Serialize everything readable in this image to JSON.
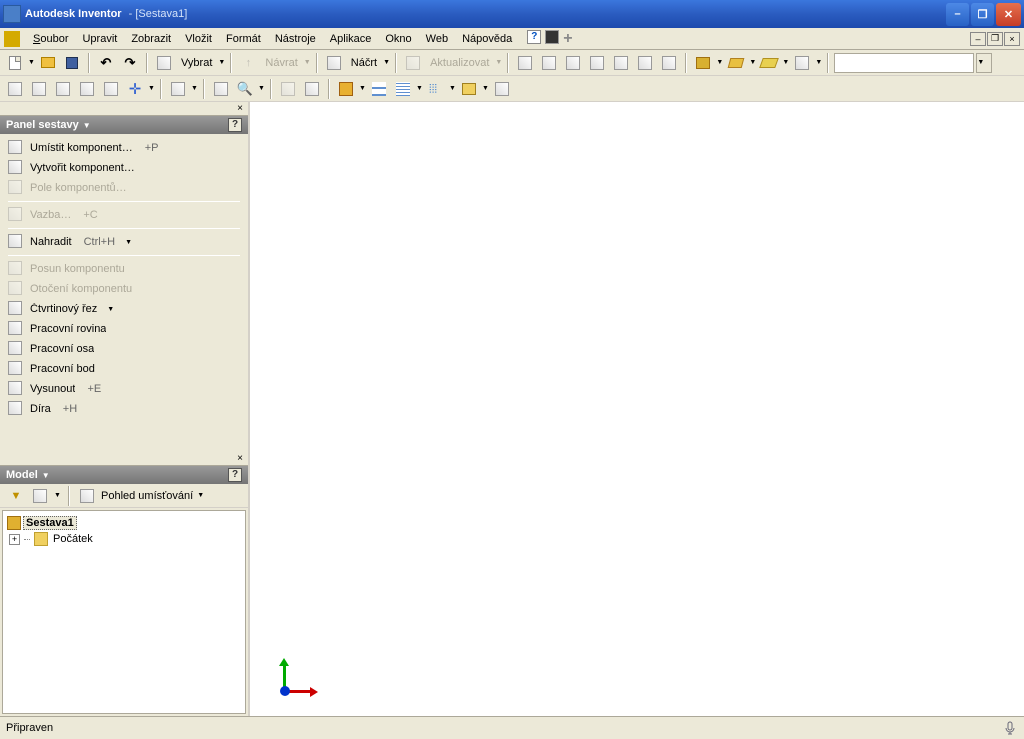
{
  "titlebar": {
    "app": "Autodesk Inventor",
    "doc": "[Sestava1]"
  },
  "menu": {
    "items": [
      "Soubor",
      "Upravit",
      "Zobrazit",
      "Vložit",
      "Formát",
      "Nástroje",
      "Aplikace",
      "Okno",
      "Web",
      "Nápověda"
    ]
  },
  "toolbar1": {
    "select_label": "Vybrat",
    "return_label": "Návrat",
    "sketch_label": "Náčrt",
    "update_label": "Aktualizovat"
  },
  "panel_assembly": {
    "title": "Panel sestavy",
    "items": [
      {
        "label": "Umístit komponent…",
        "shortcut": "+P",
        "disabled": false,
        "dropdown": false
      },
      {
        "label": "Vytvořit komponent…",
        "shortcut": "",
        "disabled": false,
        "dropdown": false
      },
      {
        "label": "Pole komponentů…",
        "shortcut": "",
        "disabled": true,
        "dropdown": false
      },
      {
        "sep": true
      },
      {
        "label": "Vazba…",
        "shortcut": "+C",
        "disabled": true,
        "dropdown": false
      },
      {
        "sep": true
      },
      {
        "label": "Nahradit",
        "shortcut": "Ctrl+H",
        "disabled": false,
        "dropdown": true
      },
      {
        "sep": true
      },
      {
        "label": "Posun komponentu",
        "shortcut": "",
        "disabled": true,
        "dropdown": false
      },
      {
        "label": "Otočení komponentu",
        "shortcut": "",
        "disabled": true,
        "dropdown": false
      },
      {
        "label": "Čtvrtinový řez",
        "shortcut": "",
        "disabled": false,
        "dropdown": true
      },
      {
        "label": "Pracovní rovina",
        "shortcut": "",
        "disabled": false,
        "dropdown": false
      },
      {
        "label": "Pracovní osa",
        "shortcut": "",
        "disabled": false,
        "dropdown": false
      },
      {
        "label": "Pracovní bod",
        "shortcut": "",
        "disabled": false,
        "dropdown": false
      },
      {
        "label": "Vysunout",
        "shortcut": "+E",
        "disabled": false,
        "dropdown": false
      },
      {
        "label": "Díra",
        "shortcut": "+H",
        "disabled": false,
        "dropdown": false
      }
    ]
  },
  "panel_model": {
    "title": "Model",
    "view_label": "Pohled umísťování",
    "tree": {
      "root": "Sestava1",
      "child": "Počátek"
    }
  },
  "statusbar": {
    "text": "Připraven"
  }
}
